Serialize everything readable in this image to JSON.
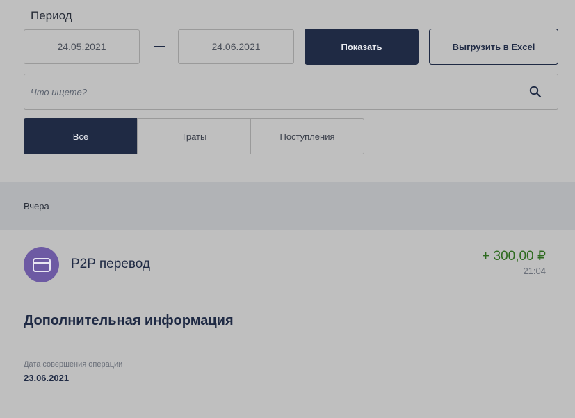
{
  "filters": {
    "period_label": "Период",
    "date_from": "24.05.2021",
    "date_to": "24.06.2021",
    "show_button": "Показать",
    "excel_button": "Выгрузить в Excel"
  },
  "search": {
    "placeholder": "Что ищете?"
  },
  "tabs": [
    {
      "label": "Все",
      "active": true
    },
    {
      "label": "Траты",
      "active": false
    },
    {
      "label": "Поступления",
      "active": false
    }
  ],
  "feed": {
    "day_label": "Вчера",
    "operation": {
      "icon": "card-icon",
      "title": "P2P перевод",
      "amount": "+ 300,00 ₽",
      "time": "21:04"
    }
  },
  "details": {
    "title": "Дополнительная информация",
    "date_label": "Дата совершения операции",
    "date_value": "23.06.2021"
  },
  "colors": {
    "primary": "#1f2a44",
    "accent_avatar": "#6d5aa3",
    "positive_amount": "#2e6b1f",
    "background": "#bfbfbf"
  }
}
